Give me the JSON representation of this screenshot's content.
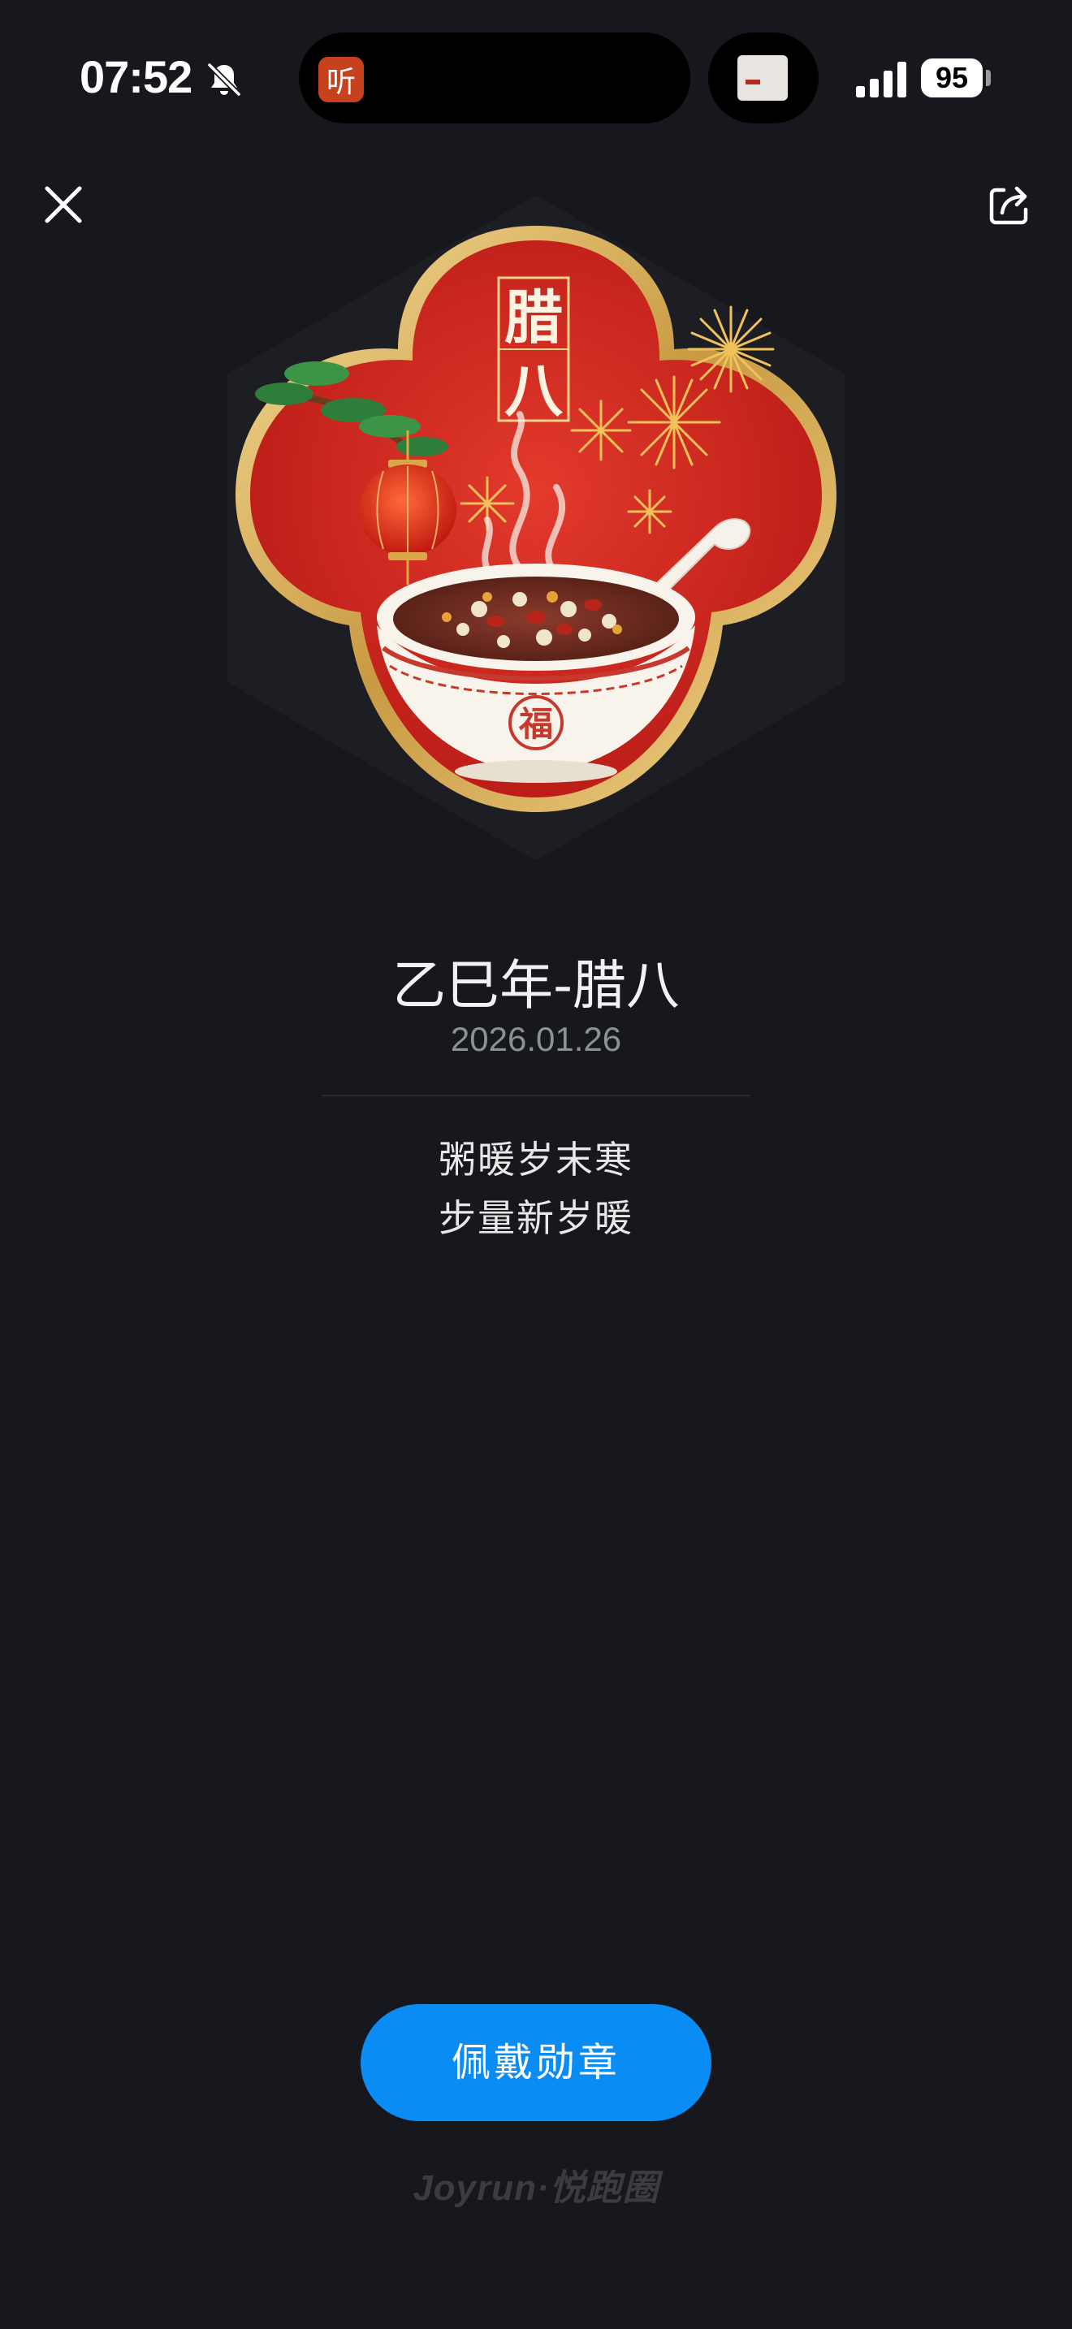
{
  "status_bar": {
    "time": "07:52",
    "battery": "95",
    "island_app_glyph": "听",
    "icons": [
      "bell-muted-icon",
      "signal-icon",
      "battery-icon"
    ]
  },
  "header": {
    "close_icon": "close-icon",
    "share_icon": "share-icon"
  },
  "badge": {
    "image_text_top": "腊",
    "image_text_bottom": "八",
    "bowl_mark": "福",
    "colors": {
      "red": "#d7261e",
      "gold": "#e2b45c"
    }
  },
  "details": {
    "name": "乙巳年-腊八",
    "date": "2026.01.26",
    "poem_line_1": "粥暖岁末寒",
    "poem_line_2": "步量新岁暖"
  },
  "actions": {
    "wear_button_label": "佩戴勋章",
    "accent_color": "#0a8cf5"
  },
  "footer": {
    "brand": "Joyrun·悦跑圈"
  }
}
